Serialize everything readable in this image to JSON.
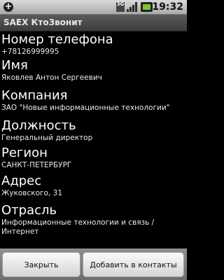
{
  "status_bar": {
    "network_type": "3G",
    "time": "19:32"
  },
  "app": {
    "title": "SAEX КтоЗвонит"
  },
  "fields": [
    {
      "label": "Номер телефона",
      "value": "+78126999995"
    },
    {
      "label": "Имя",
      "value": "Яковлев Антон Сергеевич"
    },
    {
      "label": "Компания",
      "value": "ЗАО \"Новые информационные технологии\""
    },
    {
      "label": "Должность",
      "value": "Генеральный директор"
    },
    {
      "label": "Регион",
      "value": "САНКТ-ПЕТЕРБУРГ"
    },
    {
      "label": "Адрес",
      "value": "Жуковского, 31"
    },
    {
      "label": "Отрасль",
      "value": "Информационные технологии и связь / Интернет"
    }
  ],
  "buttons": {
    "close_label": "Закрыть",
    "add_label": "Добавить в контакты"
  },
  "icons": {
    "notification": "plus-circle-icon",
    "signal": "signal-strength-icon",
    "battery": "battery-icon"
  },
  "colors": {
    "background": "#000000",
    "text": "#ffffff",
    "battery": "#77c82c"
  }
}
